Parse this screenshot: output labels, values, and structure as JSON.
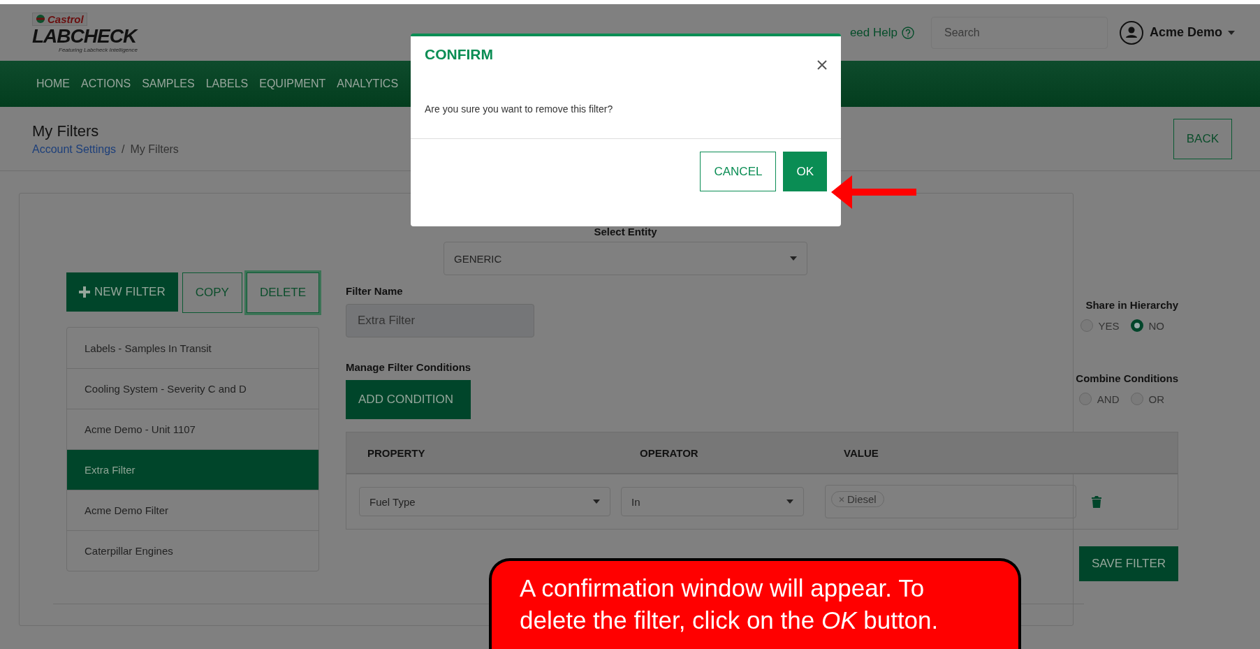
{
  "header": {
    "logo": {
      "brand": "Castrol",
      "name": "LABCHECK",
      "tagline": "Featuring Labcheck Intelligence"
    },
    "help_link": "eed Help",
    "search": {
      "placeholder": "Search"
    },
    "user": "Acme Demo"
  },
  "nav": {
    "items": [
      "HOME",
      "ACTIONS",
      "SAMPLES",
      "LABELS",
      "EQUIPMENT",
      "ANALYTICS"
    ]
  },
  "page": {
    "title": "My Filters",
    "breadcrumb": [
      {
        "label": "Account Settings",
        "kind": "link"
      },
      {
        "label": "/",
        "kind": "separator"
      },
      {
        "label": "My Filters",
        "kind": "current"
      }
    ],
    "back_button": "BACK"
  },
  "filters": {
    "buttons": [
      {
        "label": "NEW FILTER",
        "kind": "primary"
      },
      {
        "label": "COPY",
        "kind": "outline"
      },
      {
        "label": "DELETE",
        "kind": "focused"
      }
    ],
    "items": [
      {
        "label": "Labels - Samples In Transit",
        "selected": false
      },
      {
        "label": "Cooling System - Severity C and D",
        "selected": false
      },
      {
        "label": "Acme Demo - Unit 1107",
        "selected": false
      },
      {
        "label": "Extra Filter",
        "selected": true
      },
      {
        "label": "Acme Demo Filter",
        "selected": false
      },
      {
        "label": "Caterpillar Engines",
        "selected": false
      }
    ]
  },
  "editor": {
    "entity": {
      "label": "Select Entity",
      "value": "GENERIC"
    },
    "filter_name": {
      "label": "Filter Name",
      "value": "Extra Filter"
    },
    "conditions_label": "Manage Filter Conditions",
    "add_button": "ADD CONDITION",
    "table": {
      "columns": [
        "PROPERTY",
        "OPERATOR",
        "VALUE"
      ],
      "rows": [
        {
          "property": "Fuel Type",
          "operator": "In",
          "values": [
            "Diesel"
          ]
        }
      ]
    },
    "share": {
      "label": "Share in Hierarchy",
      "options": [
        {
          "label": "YES",
          "selected": false
        },
        {
          "label": "NO",
          "selected": true
        }
      ]
    },
    "combine": {
      "label": "Combine Conditions",
      "options": [
        {
          "label": "AND",
          "selected": false
        },
        {
          "label": "OR",
          "selected": false
        }
      ]
    },
    "save_button": "SAVE FILTER"
  },
  "dialog": {
    "title": "CONFIRM",
    "message": "Are you sure you want to remove this filter?",
    "buttons": [
      {
        "label": "CANCEL",
        "kind": "outline"
      },
      {
        "label": "OK",
        "kind": "primary"
      }
    ]
  },
  "callout": {
    "text": "A confirmation window will appear. To delete the filter, click on the *OK* button."
  }
}
